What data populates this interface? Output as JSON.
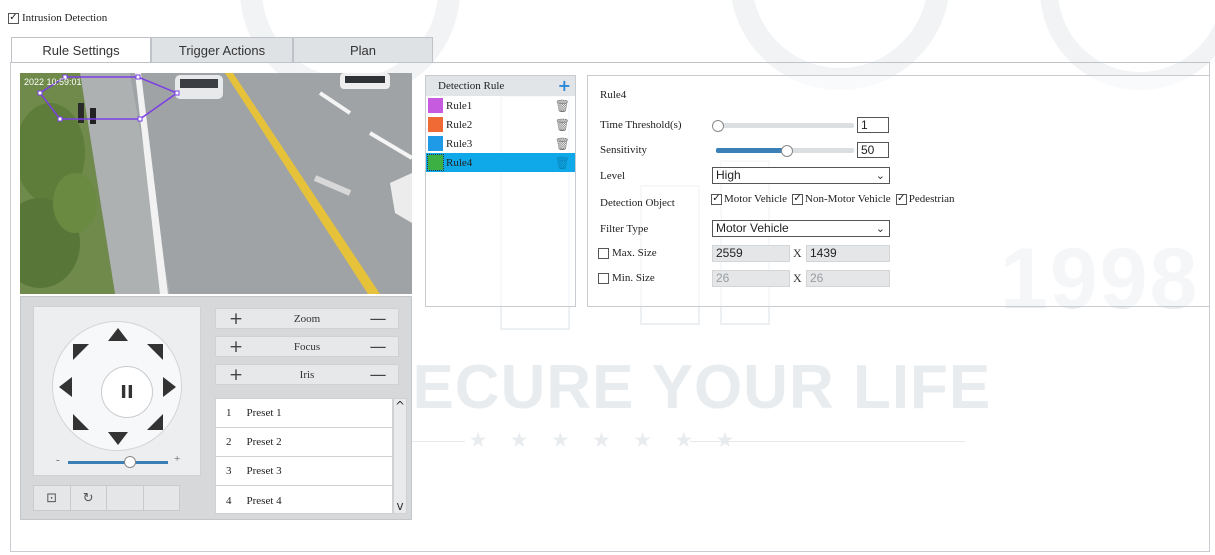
{
  "header": {
    "title": "Intrusion Detection",
    "checked": true
  },
  "tabs": [
    {
      "label": "Rule Settings",
      "active": true
    },
    {
      "label": "Trigger Actions",
      "active": false
    },
    {
      "label": "Plan",
      "active": false
    }
  ],
  "video": {
    "timestamp": "2022 10:59:01"
  },
  "ptz": {
    "controls": [
      {
        "label": "Zoom",
        "plus": "+",
        "minus": "—"
      },
      {
        "label": "Focus",
        "plus": "+",
        "minus": "—"
      },
      {
        "label": "Iris",
        "plus": "+",
        "minus": "—"
      }
    ],
    "speed_level": 0.62,
    "speed_minus": "-",
    "speed_plus": "+",
    "presets": [
      {
        "num": "1",
        "name": "Preset 1"
      },
      {
        "num": "2",
        "name": "Preset 2"
      },
      {
        "num": "3",
        "name": "Preset 3"
      },
      {
        "num": "4",
        "name": "Preset 4"
      }
    ],
    "scroll_up": "^",
    "scroll_down": "v"
  },
  "detection_rules": {
    "header": "Detection Rule",
    "add_icon": "+",
    "rules": [
      {
        "name": "Rule1",
        "color": "#c65be0",
        "selected": false
      },
      {
        "name": "Rule2",
        "color": "#f06a36",
        "selected": false
      },
      {
        "name": "Rule3",
        "color": "#1e9ae6",
        "selected": false
      },
      {
        "name": "Rule4",
        "color": "#3cb043",
        "selected": true
      }
    ]
  },
  "settings": {
    "rule_name": "Rule4",
    "time_threshold": {
      "label": "Time Threshold(s)",
      "value": "1",
      "level": 0.0
    },
    "sensitivity": {
      "label": "Sensitivity",
      "value": "50",
      "level": 0.5
    },
    "level": {
      "label": "Level",
      "value": "High"
    },
    "detection_object": {
      "label": "Detection Object",
      "options": [
        {
          "label": "Motor Vehicle",
          "checked": true
        },
        {
          "label": "Non-Motor Vehicle",
          "checked": true
        },
        {
          "label": "Pedestrian",
          "checked": true
        }
      ]
    },
    "filter_type": {
      "label": "Filter Type",
      "value": "Motor Vehicle"
    },
    "max_size": {
      "label": "Max. Size",
      "checked": false,
      "w": "2559",
      "h": "1439"
    },
    "min_size": {
      "label": "Min. Size",
      "checked": false,
      "w": "26",
      "h": "26"
    },
    "x_sep": "X"
  },
  "colors": {
    "accent": "#2b8ad8",
    "selection": "#0fa8e8",
    "slider": "#3a7fb5",
    "polygon": "#7b3fe4"
  },
  "watermark": {
    "year": "1998",
    "slogan": "WE SECURE YOUR LIFE",
    "stars": "★ ★ ★ ★ ★ ★ ★"
  }
}
